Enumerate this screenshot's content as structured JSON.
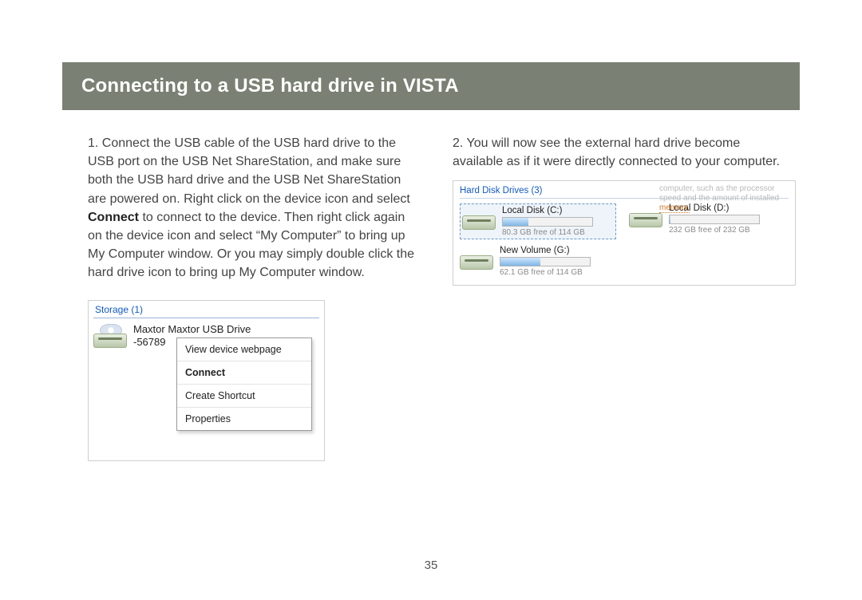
{
  "banner": {
    "title": "Connecting to a USB hard drive in VISTA"
  },
  "steps": {
    "s1_num": "1.  ",
    "s1_a": "Connect the USB cable of the USB hard drive to the USB port on the USB Net ShareStation, and make sure both the USB hard drive and the USB Net ShareStation are powered on. Right click on the device icon and select ",
    "s1_bold": "Connect",
    "s1_b": " to connect to the device.  Then right click again on the device icon and select “My Computer” to bring up My Computer window.  Or you may simply double click the hard drive icon to bring up My Computer window.",
    "s2_num": "2.  ",
    "s2_a": "You will now see the external hard drive become available as if it were directly connected to your computer."
  },
  "fig1": {
    "header": "Storage (1)",
    "device_name": "Maxtor  Maxtor USB Drive",
    "device_sub": "-56789",
    "menu": {
      "m1": "View device webpage",
      "m2": "Connect",
      "m3": "Create Shortcut",
      "m4": "Properties"
    }
  },
  "fig2": {
    "header": "Hard Disk Drives (3)",
    "hint_line1": "computer, such as the processor",
    "hint_line2a": "speed and the amount of installed ",
    "hint_line2b": "memory.",
    "drives": [
      {
        "name": "Local Disk (C:)",
        "free": "80.3 GB free of 114 GB",
        "fill": 29
      },
      {
        "name": "Local Disk (D:)",
        "free": "232 GB free of 232 GB",
        "fill": 1
      },
      {
        "name": "New Volume (G:)",
        "free": "62.1 GB free of 114 GB",
        "fill": 45
      }
    ]
  },
  "page_number": "35"
}
